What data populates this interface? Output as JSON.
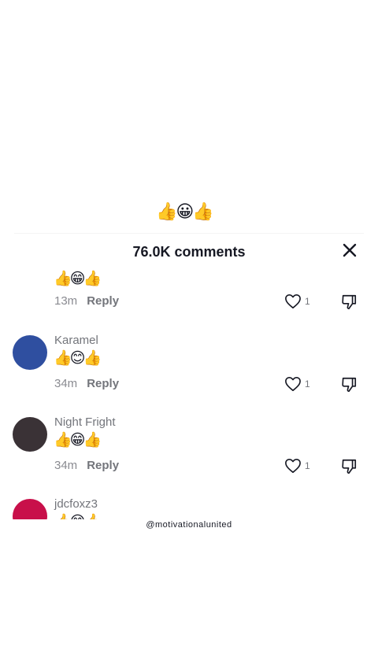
{
  "header": {
    "reaction_emojis": "👍😀👍"
  },
  "sheet": {
    "title": "76.0K comments",
    "close_icon": "close-icon"
  },
  "comments": [
    {
      "username": "",
      "text": "👍😁👍",
      "time": "13m",
      "reply_label": "Reply",
      "likes": "1",
      "avatar_color": ""
    },
    {
      "username": "Karamel",
      "text": "👍😊👍",
      "time": "34m",
      "reply_label": "Reply",
      "likes": "1",
      "avatar_color": "#2f4fa0"
    },
    {
      "username": "Night Fright",
      "text": "👍😁👍",
      "time": "34m",
      "reply_label": "Reply",
      "likes": "1",
      "avatar_color": "#3a3236"
    },
    {
      "username": "jdcfoxz3",
      "text": "👍😊👍",
      "time": "",
      "reply_label": "",
      "likes": "",
      "avatar_color": "#c8104a"
    }
  ],
  "watermark": "@motivationalunited"
}
